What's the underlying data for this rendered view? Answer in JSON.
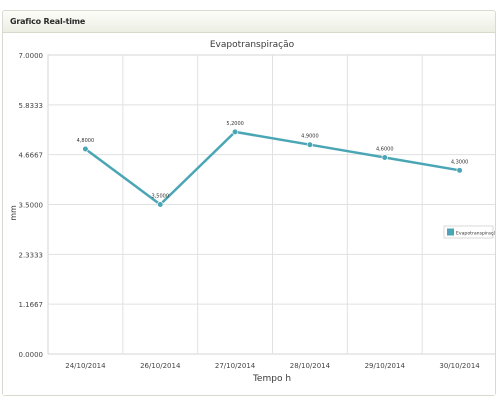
{
  "panel": {
    "title": "Grafico Real-time"
  },
  "chart_data": {
    "type": "line",
    "title": "Evapotranspiração",
    "xlabel": "Tempo h",
    "ylabel": "mm",
    "categories": [
      "24/10/2014",
      "26/10/2014",
      "27/10/2014",
      "28/10/2014",
      "29/10/2014",
      "30/10/2014"
    ],
    "series": [
      {
        "name": "Evapotranspiração",
        "values": [
          4.8,
          3.5,
          5.2,
          4.9,
          4.6,
          4.3
        ],
        "labels": [
          "4,8000",
          "3,5000",
          "5,2000",
          "4,9000",
          "4,6000",
          "4,3000"
        ],
        "color": "#4aa6b5"
      }
    ],
    "ylim": [
      0,
      7
    ],
    "yticks": [
      "0.0000",
      "1.1667",
      "2.3333",
      "3.5000",
      "4.6667",
      "5.8333",
      "7.0000"
    ],
    "grid": true,
    "legend_position": "right"
  }
}
